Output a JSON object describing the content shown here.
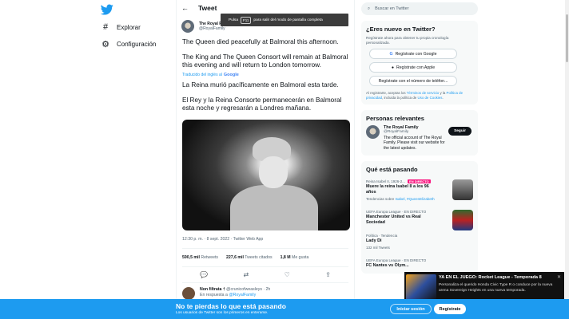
{
  "nav": {
    "logo_icon": "twitter-bird-icon",
    "items": [
      {
        "label": "Explorar",
        "icon": "hashtag-icon"
      },
      {
        "label": "Configuración",
        "icon": "gear-icon"
      }
    ]
  },
  "header": {
    "title": "Tweet",
    "back_icon": "arrow-left-icon"
  },
  "tweet": {
    "author_name": "The Royal Fam",
    "author_handle": "@RoyalFamily",
    "text_en_1": "The Queen died peacefully at Balmoral this afternoon.",
    "text_en_2": "The King and The Queen Consort will remain at Balmoral this evening and will return to London tomorrow.",
    "translated_by": "Traducido del inglés al",
    "google": "Google",
    "text_es_1": "La Reina murió pacíficamente en Balmoral esta tarde.",
    "text_es_2": "El Rey y la Reina Consorte permanecerán en Balmoral esta noche y regresarán a Londres mañana.",
    "meta": "12:30 p. m. · 8 sept. 2022 · Twitter Web App",
    "retweets_count": "590,5 mil",
    "retweets_label": "Retweets",
    "quotes_count": "227,6 mil",
    "quotes_label": "Tweets citados",
    "likes_count": "1,8 M",
    "likes_label": "Me gusta"
  },
  "fullscreen_toast": {
    "pre": "Pulsa",
    "key": "F11",
    "post": "para salir del modo de pantalla completa"
  },
  "reply": {
    "name": "Non filtrata †",
    "handle": "@crunicofweasleys · 2h",
    "in_reply_prefix": "En respuesta a",
    "in_reply_to": "@RoyalFamily"
  },
  "search": {
    "placeholder": "Buscar en Twitter"
  },
  "signup": {
    "title": "¿Eres nuevo en Twitter?",
    "desc": "Regístrate ahora para obtener tu propia cronología personalizada.",
    "google_btn": "Regístrate con Google",
    "apple_btn": "Regístrate con Apple",
    "phone_btn": "Regístrate con el número de teléfon...",
    "legal_1": "Al registrarte, aceptas los",
    "legal_terms": "Términos de servicio",
    "legal_2": "y la",
    "legal_privacy": "Política de privacidad",
    "legal_3": ", incluida la política de",
    "legal_cookies": "Uso de Cookies",
    "legal_4": "."
  },
  "relevant": {
    "title": "Personas relevantes",
    "name": "The Royal Family",
    "handle": "@RoyalFamily",
    "follow_label": "Seguir",
    "bio": "The official account of The Royal Family. Please visit our website for the latest updates."
  },
  "trends": {
    "title": "Qué está pasando",
    "items": [
      {
        "cat": "Reina Isabel II, 1926-2...",
        "live": "EN DIRECTO",
        "title": "Muere la reina Isabel II a los 96 años",
        "desc_pre": "Tendencias sobre",
        "desc_link": "Isabel, #QueenElizabeth"
      },
      {
        "cat": "UEFA Europa League · EN DIRECTO",
        "title": "Manchester United vs Real Sociedad"
      },
      {
        "cat": "Política · Tendencia",
        "title": "Lady Di",
        "desc_pre": "132 mil Tweets"
      },
      {
        "cat": "UEFA Europa League · EN DIRECTO",
        "title": "FC Nantes vs Olym..."
      }
    ]
  },
  "banner": {
    "title": "No te pierdas lo que está pasando",
    "subtitle": "Los usuarios de Twitter son los primeros en enterarse.",
    "login": "Iniciar sesión",
    "register": "Regístrate"
  },
  "notification": {
    "title": "YA EN EL JUEGO: Rocket League - Temporada 8",
    "desc": "Personaliza el querido Honda Civic Type R o conduce por la nueva arena Sovereign Heights en una nueva temporada.",
    "close_icon": "close-icon"
  }
}
